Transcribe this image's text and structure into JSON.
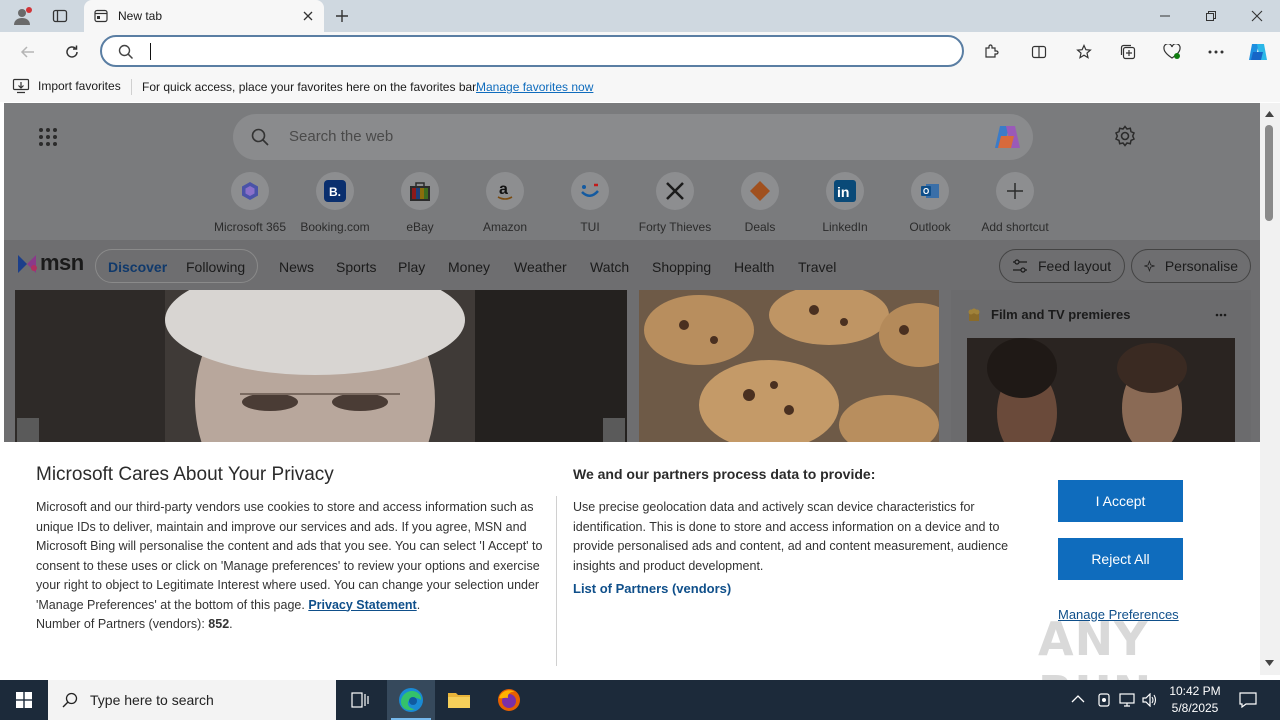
{
  "browser": {
    "tab_title": "New tab",
    "address_value": "",
    "favorites_bar": {
      "import_label": "Import favorites",
      "hint": "For quick access, place your favorites here on the favorites bar.",
      "manage_link": "Manage favorites now"
    }
  },
  "newtab": {
    "search_placeholder": "Search the web",
    "shortcuts": [
      {
        "label": "Microsoft 365",
        "icon": "microsoft-365-icon"
      },
      {
        "label": "Booking.com",
        "icon": "booking-icon"
      },
      {
        "label": "eBay",
        "icon": "ebay-icon"
      },
      {
        "label": "Amazon",
        "icon": "amazon-icon"
      },
      {
        "label": "TUI",
        "icon": "tui-icon"
      },
      {
        "label": "Forty Thieves",
        "icon": "forty-thieves-icon"
      },
      {
        "label": "Deals",
        "icon": "deals-icon"
      },
      {
        "label": "LinkedIn",
        "icon": "linkedin-icon"
      },
      {
        "label": "Outlook",
        "icon": "outlook-icon"
      },
      {
        "label": "Add shortcut",
        "icon": "plus-icon"
      }
    ],
    "msn": {
      "logo": "msn",
      "discover": "Discover",
      "following": "Following",
      "nav": [
        "News",
        "Sports",
        "Play",
        "Money",
        "Weather",
        "Watch",
        "Shopping",
        "Health",
        "Travel"
      ],
      "feed_layout": "Feed layout",
      "personalise": "Personalise",
      "widget_title": "Film and TV premieres"
    }
  },
  "privacy": {
    "title": "Microsoft Cares About Your Privacy",
    "body": "Microsoft and our third-party vendors use cookies to store and access information such as unique IDs to deliver, maintain and improve our services and ads. If you agree, MSN and Microsoft Bing will personalise the content and ads that you see. You can select 'I Accept' to consent to these uses or click on 'Manage preferences' to review your options and exercise your right to object to Legitimate Interest where used.  You can change your selection under 'Manage Preferences' at the bottom of this page.",
    "privacy_link": "Privacy Statement",
    "partners_label": "Number of Partners (vendors):",
    "partners_count": "852",
    "right_title": "We and our partners process data to provide:",
    "right_body": "Use precise geolocation data and actively scan device characteristics for identification. This is done to store and access information on a device and to provide personalised ads and content, ad and content measurement, audience insights and product development.",
    "partners_link": "List of Partners (vendors)",
    "accept": "I Accept",
    "reject": "Reject All",
    "manage": "Manage Preferences",
    "watermark": "ANY RUN"
  },
  "taskbar": {
    "search_placeholder": "Type here to search",
    "time": "10:42 PM",
    "date": "5/8/2025"
  },
  "colors": {
    "accent": "#0f6cbd",
    "address_border": "#5a7ea3",
    "taskbar": "#1c2a3a"
  }
}
